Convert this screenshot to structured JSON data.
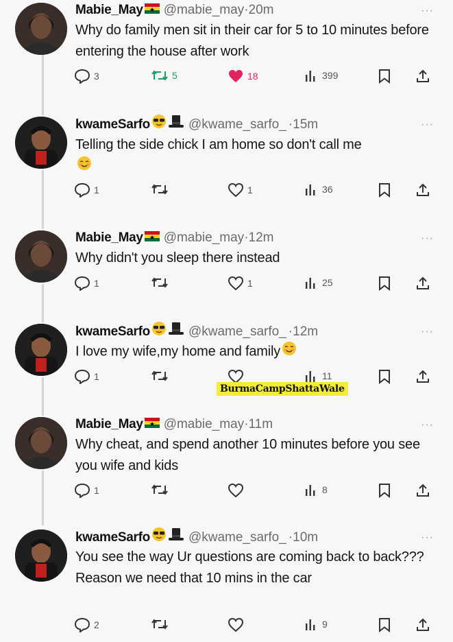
{
  "tweets": [
    {
      "name": "Mabie_May",
      "name_emoji": "flag-ghana",
      "handle": "@mabie_may",
      "time": "20m",
      "text": "Why do family men sit in their car for 5 to 10 minutes before entering the house after work",
      "replies": "3",
      "retweets": "5",
      "likes": "18",
      "views": "399",
      "liked": true
    },
    {
      "name": "kwameSarfo",
      "name_emoji": "sunglasses-face, top-hat",
      "handle": "@kwame_sarfo_",
      "time": "15m",
      "text": "Telling the side chick I am home so don't call me",
      "text_emoji": "blush-face",
      "replies": "1",
      "retweets": "",
      "likes": "1",
      "views": "36"
    },
    {
      "name": "Mabie_May",
      "name_emoji": "flag-ghana",
      "handle": "@mabie_may",
      "time": "12m",
      "text": "Why didn't you sleep there instead",
      "replies": "1",
      "retweets": "",
      "likes": "1",
      "views": "25"
    },
    {
      "name": "kwameSarfo",
      "name_emoji": "sunglasses-face, top-hat",
      "handle": "@kwame_sarfo_",
      "time": "12m",
      "text": "I love my wife,my home and family",
      "text_emoji": "blush-face",
      "replies": "1",
      "retweets": "",
      "likes": "",
      "views": "11"
    },
    {
      "name": "Mabie_May",
      "name_emoji": "flag-ghana",
      "handle": "@mabie_may",
      "time": "11m",
      "text": "Why cheat, and spend another 10 minutes before you see you wife and kids",
      "replies": "1",
      "retweets": "",
      "likes": "",
      "views": "8"
    },
    {
      "name": "kwameSarfo",
      "name_emoji": "sunglasses-face, top-hat",
      "handle": "@kwame_sarfo_",
      "time": "10m",
      "text": "You see the way Ur questions are coming back to back??? Reason we need that 10 mins in the car",
      "replies": "2",
      "retweets": "",
      "likes": "",
      "views": "9"
    }
  ],
  "separator": "·",
  "more_glyph": "···",
  "watermark": "BurmaCampShattaWale",
  "colors": {
    "like": "#e0245e",
    "retweet": "#17a06a",
    "muted": "#6b6b6b"
  }
}
